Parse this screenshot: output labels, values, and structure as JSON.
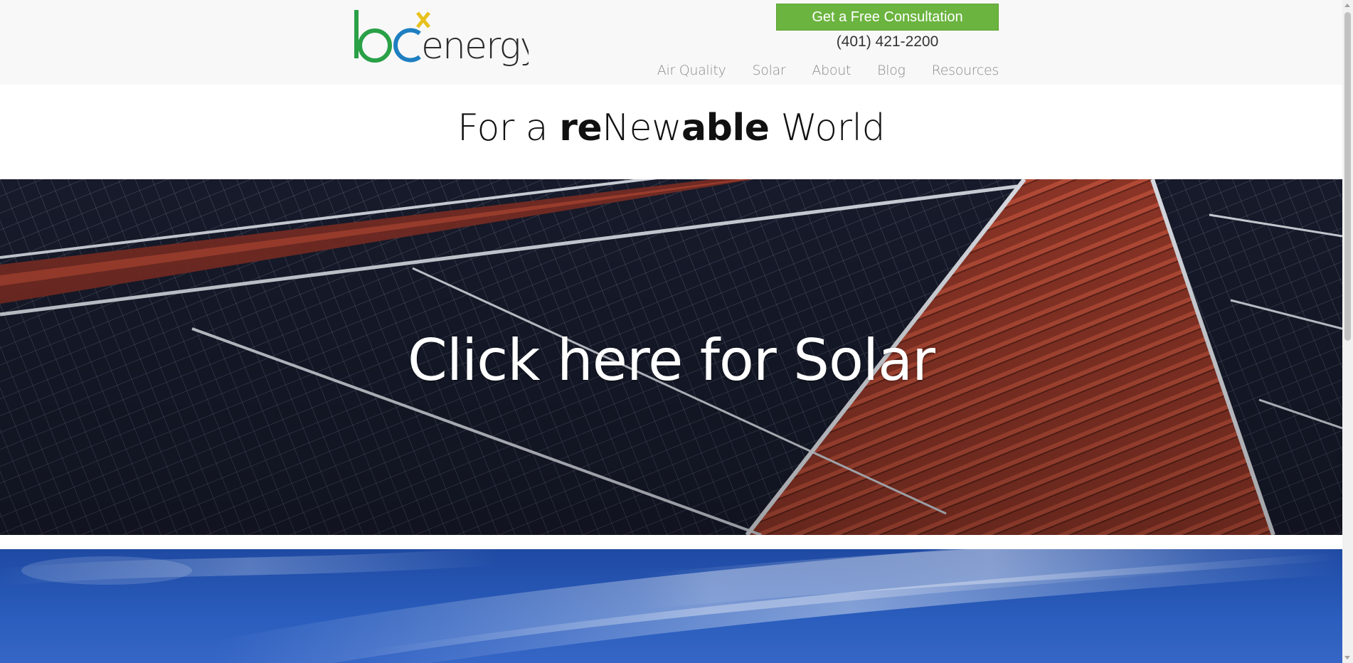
{
  "header": {
    "logo": {
      "letters": "bc",
      "superscript": "x",
      "word": "energy",
      "colors": {
        "b": "#2aa047",
        "c": "#1e7fc1",
        "x": "#e8c11c",
        "word": "#2b2b2b"
      }
    },
    "cta_label": "Get a Free Consultation",
    "phone": "(401) 421-2200",
    "nav": [
      {
        "label": "Air Quality"
      },
      {
        "label": "Solar"
      },
      {
        "label": "About"
      },
      {
        "label": "Blog"
      },
      {
        "label": "Resources"
      }
    ]
  },
  "tagline": {
    "part1": "For a ",
    "part2": "re",
    "part3": "New",
    "part4": "able",
    "part5": " World"
  },
  "solar_banner": {
    "title": "Click here for Solar",
    "image": "solar-panels-on-red-roof"
  },
  "sky_banner": {
    "image": "blue-sky-with-clouds"
  },
  "colors": {
    "accent": "#6bb43f",
    "header_bg": "#f8f8f8",
    "nav_text": "#8a8a8a"
  }
}
